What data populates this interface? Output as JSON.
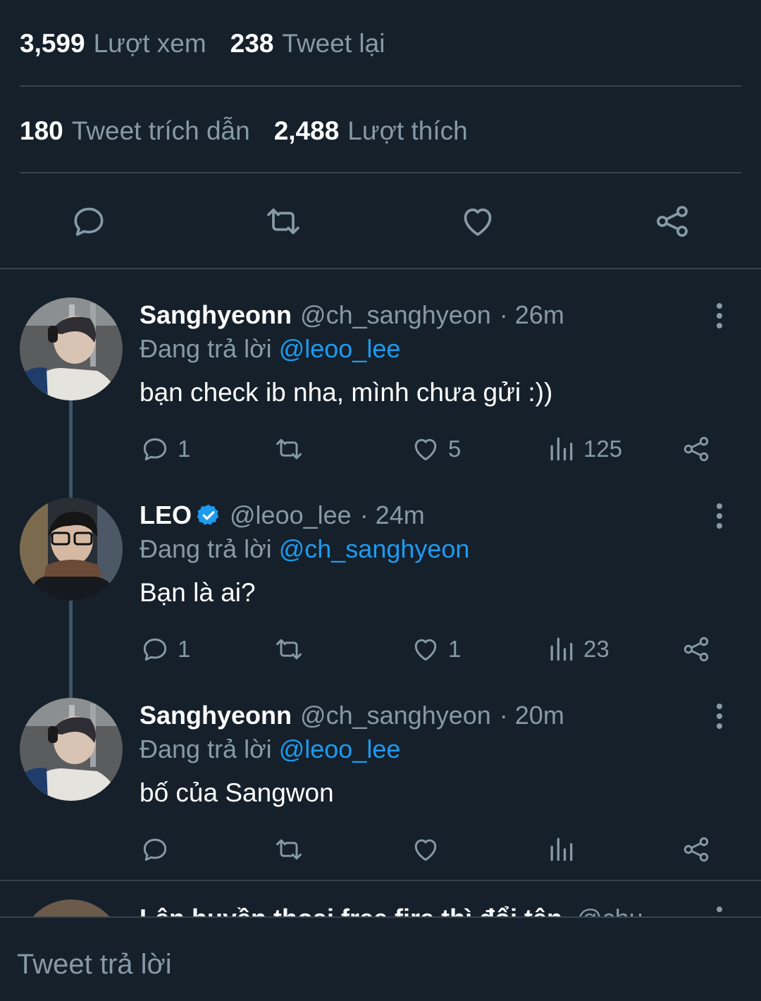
{
  "stats": {
    "views_count": "3,599",
    "views_label": "Lượt xem",
    "retweets_count": "238",
    "retweets_label": "Tweet lại",
    "quotes_count": "180",
    "quotes_label": "Tweet trích dẫn",
    "likes_count": "2,488",
    "likes_label": "Lượt thích"
  },
  "replies": [
    {
      "name": "Sanghyeonn",
      "handle": "@ch_sanghyeon",
      "time": "· 26m",
      "replying_prefix": "Đang trả lời",
      "replying_to": "@leoo_lee",
      "text": "bạn check ib nha, mình chưa gửi :))",
      "reply_count": "1",
      "retweet_count": "",
      "like_count": "5",
      "view_count": "125"
    },
    {
      "name": "LEO",
      "handle": "@leoo_lee",
      "time": "· 24m",
      "replying_prefix": "Đang trả lời",
      "replying_to": "@ch_sanghyeon",
      "text": "Bạn là ai?",
      "reply_count": "1",
      "retweet_count": "",
      "like_count": "1",
      "view_count": "23"
    },
    {
      "name": "Sanghyeonn",
      "handle": "@ch_sanghyeon",
      "time": "· 20m",
      "replying_prefix": "Đang trả lời",
      "replying_to": "@leoo_lee",
      "text": "bố của Sangwon",
      "reply_count": "",
      "retweet_count": "",
      "like_count": "",
      "view_count": ""
    }
  ],
  "partial_tweet": {
    "text": "Lên huyền thoại free fire thì đổi tên",
    "handle": "@chu"
  },
  "composer": {
    "placeholder": "Tweet trả lời"
  },
  "colors": {
    "background": "#15202b",
    "muted": "#8899a6",
    "accent": "#1d9bf0",
    "divider": "#38444d"
  }
}
